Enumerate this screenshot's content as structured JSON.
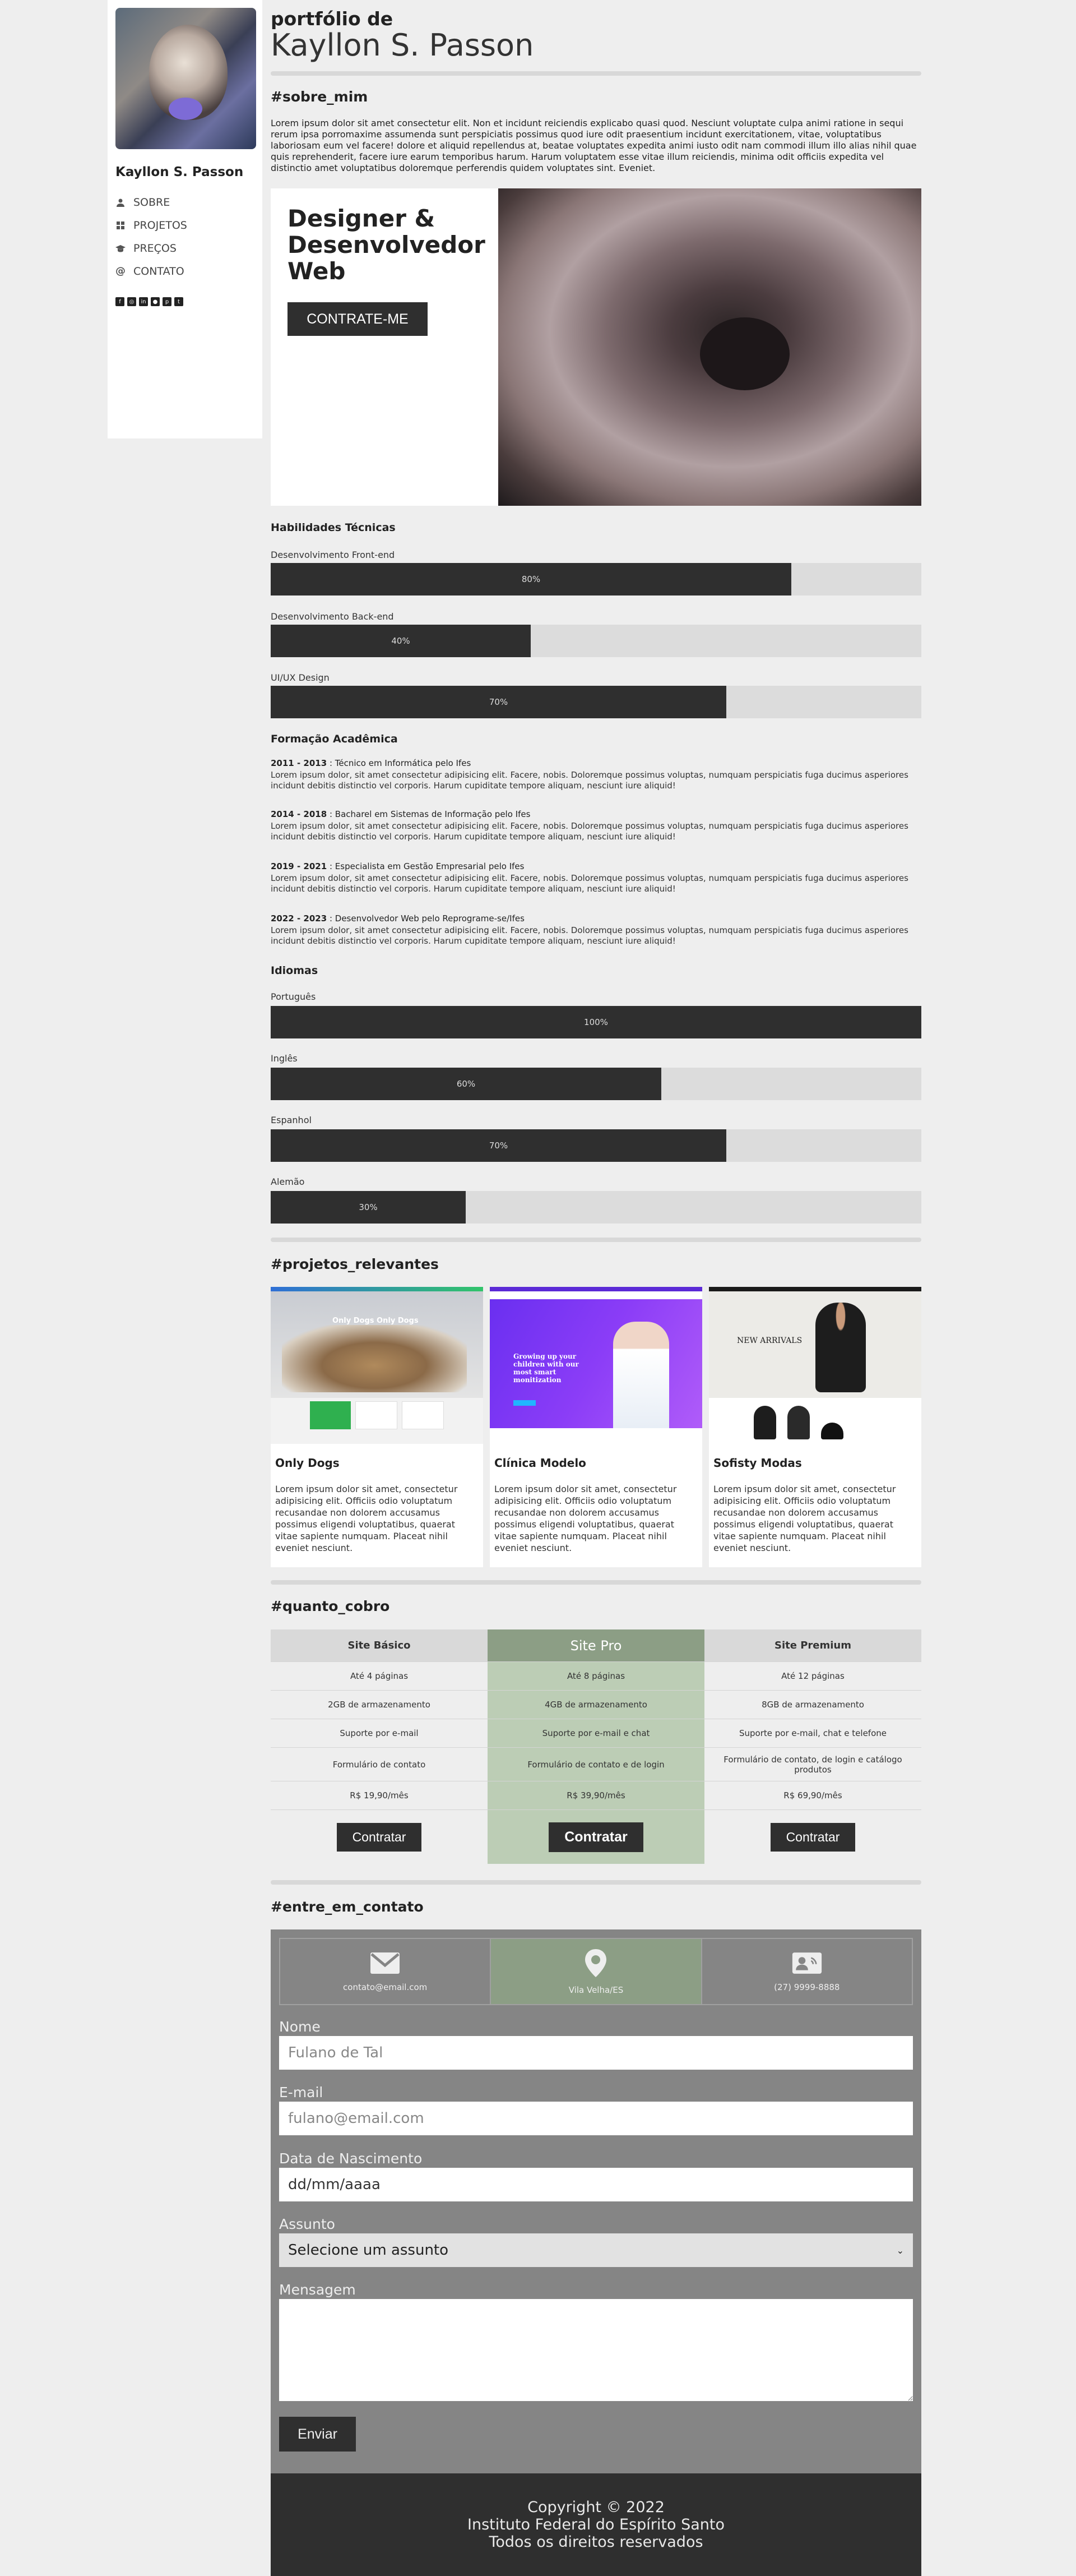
{
  "sidebar": {
    "name": "Kayllon S. Passon",
    "nav": [
      {
        "icon": "user-icon",
        "label": "SOBRE"
      },
      {
        "icon": "grid-icon",
        "label": "PROJETOS"
      },
      {
        "icon": "graduation-cap-icon",
        "label": "PREÇOS"
      },
      {
        "icon": "at-icon",
        "label": "CONTATO"
      }
    ],
    "social": [
      "facebook-icon",
      "instagram-icon",
      "linkedin-icon",
      "github-icon",
      "pinterest-icon",
      "twitter-icon"
    ]
  },
  "header": {
    "subtitle": "portfólio de",
    "title": "Kayllon S. Passon"
  },
  "about": {
    "heading": "#sobre_mim",
    "text": "Lorem ipsum dolor sit amet consectetur elit. Non et incidunt reiciendis explicabo quasi quod. Nesciunt voluptate culpa animi ratione in sequi rerum ipsa porromaxime assumenda sunt perspiciatis possimus quod iure odit praesentium incidunt exercitationem, vitae, voluptatibus laboriosam eum vel facere! dolore et aliquid repellendus at, beatae voluptates expedita animi iusto odit nam commodi illum illo alias nihil quae quis reprehenderit, facere iure earum temporibus harum. Harum voluptatem esse vitae illum reiciendis, minima odit officiis expedita vel distinctio amet voluptatibus doloremque perferendis quidem voluptates sint. Eveniet.",
    "hero_title": "Designer & Desenvolvedor Web",
    "hero_button": "CONTRATE-ME"
  },
  "skills": {
    "heading": "Habilidades Técnicas",
    "items": [
      {
        "label": "Desenvolvimento Front-end",
        "value": 80,
        "text": "80%"
      },
      {
        "label": "Desenvolvimento Back-end",
        "value": 40,
        "text": "40%"
      },
      {
        "label": "UI/UX Design",
        "value": 70,
        "text": "70%"
      }
    ]
  },
  "education": {
    "heading": "Formação Acadêmica",
    "items": [
      {
        "years": "2011 - 2013",
        "title": ": Técnico em Informática pelo Ifes",
        "text": "Lorem ipsum dolor, sit amet consectetur adipisicing elit. Facere, nobis. Doloremque possimus voluptas, numquam perspiciatis fuga ducimus asperiores incidunt debitis distinctio vel corporis. Harum cupiditate tempore aliquam, nesciunt iure aliquid!"
      },
      {
        "years": "2014 - 2018",
        "title": ": Bacharel em Sistemas de Informação pelo Ifes",
        "text": "Lorem ipsum dolor, sit amet consectetur adipisicing elit. Facere, nobis. Doloremque possimus voluptas, numquam perspiciatis fuga ducimus asperiores incidunt debitis distinctio vel corporis. Harum cupiditate tempore aliquam, nesciunt iure aliquid!"
      },
      {
        "years": "2019 - 2021",
        "title": ": Especialista em Gestão Empresarial pelo Ifes",
        "text": "Lorem ipsum dolor, sit amet consectetur adipisicing elit. Facere, nobis. Doloremque possimus voluptas, numquam perspiciatis fuga ducimus asperiores incidunt debitis distinctio vel corporis. Harum cupiditate tempore aliquam, nesciunt iure aliquid!"
      },
      {
        "years": "2022 - 2023",
        "title": ": Desenvolvedor Web pelo Reprograme-se/Ifes",
        "text": "Lorem ipsum dolor, sit amet consectetur adipisicing elit. Facere, nobis. Doloremque possimus voluptas, numquam perspiciatis fuga ducimus asperiores incidunt debitis distinctio vel corporis. Harum cupiditate tempore aliquam, nesciunt iure aliquid!"
      }
    ]
  },
  "languages": {
    "heading": "Idiomas",
    "items": [
      {
        "label": "Português",
        "value": 100,
        "text": "100%"
      },
      {
        "label": "Inglês",
        "value": 60,
        "text": "60%"
      },
      {
        "label": "Espanhol",
        "value": 70,
        "text": "70%"
      },
      {
        "label": "Alemão",
        "value": 30,
        "text": "30%"
      }
    ]
  },
  "projects": {
    "heading": "#projetos_relevantes",
    "items": [
      {
        "title": "Only Dogs",
        "text": "Lorem ipsum dolor sit amet, consectetur adipisicing elit. Officiis odio voluptatum recusandae non dolorem accusamus possimus eligendi voluptatibus, quaerat vitae sapiente numquam. Placeat nihil eveniet nesciunt."
      },
      {
        "title": "Clínica Modelo",
        "text": "Lorem ipsum dolor sit amet, consectetur adipisicing elit. Officiis odio voluptatum recusandae non dolorem accusamus possimus eligendi voluptatibus, quaerat vitae sapiente numquam. Placeat nihil eveniet nesciunt."
      },
      {
        "title": "Sofisty Modas",
        "text": "Lorem ipsum dolor sit amet, consectetur adipisicing elit. Officiis odio voluptatum recusandae non dolorem accusamus possimus eligendi voluptatibus, quaerat vitae sapiente numquam. Placeat nihil eveniet nesciunt."
      }
    ],
    "thumb_texts": {
      "only_dogs_hero": "Only Dogs Only Dogs",
      "clinica_hero": "Growing up your children with our most smart monitization",
      "sofisty_hero": "NEW ARRIVALS"
    }
  },
  "pricing": {
    "heading": "#quanto_cobro",
    "plans": [
      {
        "name": "Site Básico",
        "features": [
          "Até 4 páginas",
          "2GB de armazenamento",
          "Suporte por e-mail",
          "Formulário de contato"
        ],
        "price": "R$ 19,90/mês",
        "button": "Contratar"
      },
      {
        "name": "Site Pro",
        "features": [
          "Até 8 páginas",
          "4GB de armazenamento",
          "Suporte por e-mail e chat",
          "Formulário de contato e de login"
        ],
        "price": "R$ 39,90/mês",
        "button": "Contratar"
      },
      {
        "name": "Site Premium",
        "features": [
          "Até 12 páginas",
          "8GB de armazenamento",
          "Suporte por e-mail, chat e telefone",
          "Formulário de contato, de login e catálogo produtos"
        ],
        "price": "R$ 69,90/mês",
        "button": "Contratar"
      }
    ],
    "highlight_color": "#8c9e85"
  },
  "contact": {
    "heading": "#entre_em_contato",
    "cards": [
      {
        "icon": "envelope-icon",
        "text": "contato@email.com"
      },
      {
        "icon": "map-pin-icon",
        "text": "Vila Velha/ES"
      },
      {
        "icon": "contact-card-icon",
        "text": "(27) 9999-8888"
      }
    ],
    "form": {
      "name_label": "Nome",
      "name_placeholder": "Fulano de Tal",
      "email_label": "E-mail",
      "email_placeholder": "fulano@email.com",
      "birth_label": "Data de Nascimento",
      "birth_value": "dd/mm/aaaa",
      "subject_label": "Assunto",
      "subject_value": "Selecione um assunto",
      "message_label": "Mensagem",
      "submit": "Enviar"
    }
  },
  "footer": {
    "line1": "Copyright © 2022",
    "line2": "Instituto Federal do Espírito Santo",
    "line3": "Todos os direitos reservados"
  }
}
